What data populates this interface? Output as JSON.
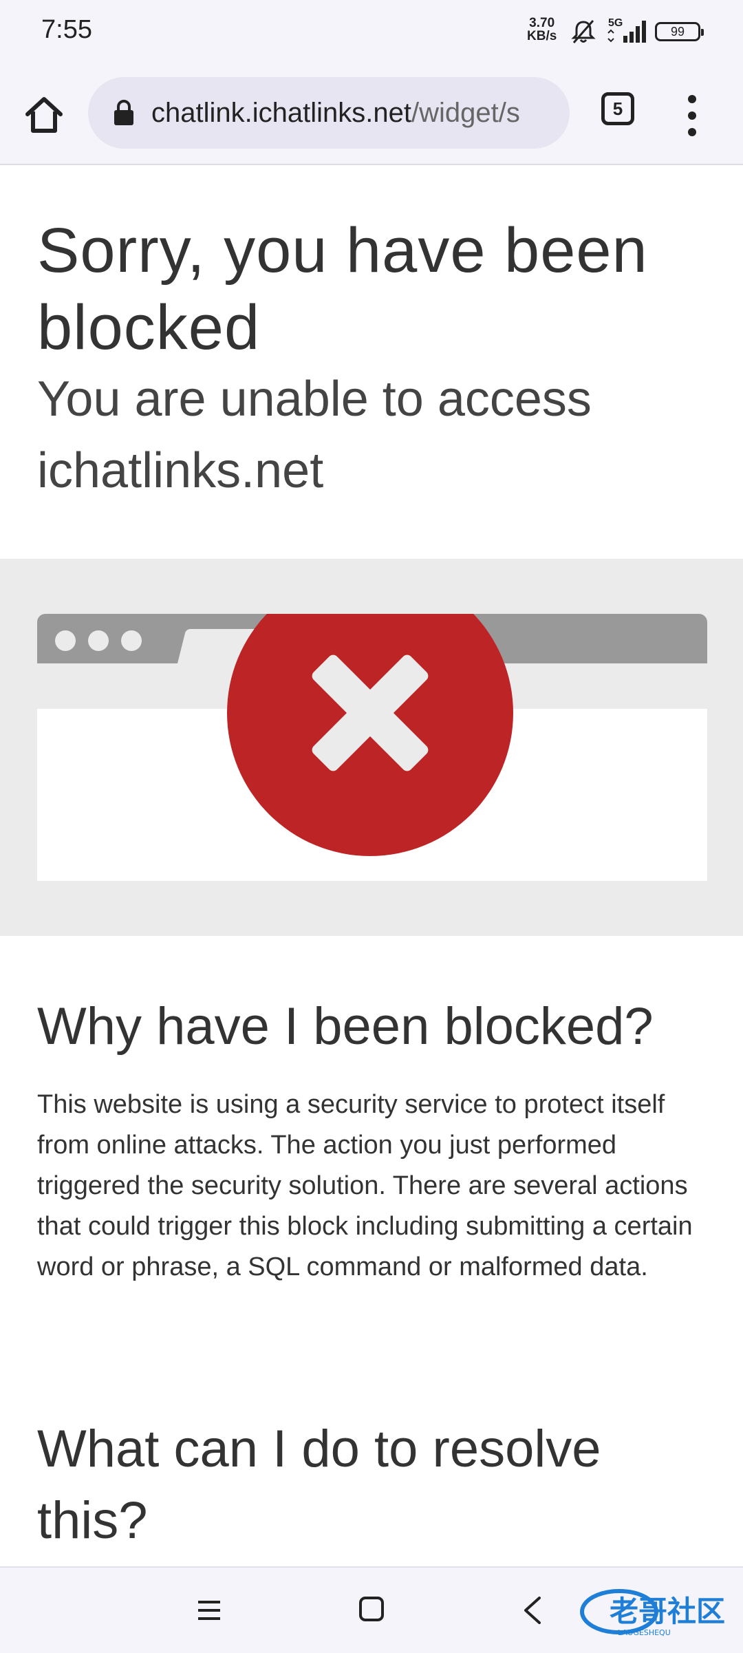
{
  "status_bar": {
    "time": "7:55",
    "speed_value": "3.70",
    "speed_unit": "KB/s",
    "network": "5G",
    "battery": "99"
  },
  "toolbar": {
    "url_host": "chatlink.ichatlinks.net",
    "url_path": "/widget/s",
    "tab_count": "5"
  },
  "page": {
    "title": "Sorry, you have been blocked",
    "subtitle": "You are unable to access ichatlinks.net",
    "why_heading": "Why have I been blocked?",
    "why_text": "This website is using a security service to protect itself from online attacks. The action you just performed triggered the security solution. There are several actions that could trigger this block including submitting a certain word or phrase, a SQL command or malformed data.",
    "resolve_heading": "What can I do to resolve this?"
  },
  "watermark": {
    "text": "老哥社区",
    "sub": "LAOGESHEQU"
  },
  "colors": {
    "error_red": "#bd2426",
    "chrome_bg": "#f6f4fb",
    "url_bar_bg": "#e8e5f2",
    "hero_bg": "#ebebeb",
    "browser_gray": "#999999"
  },
  "icons": [
    "home-icon",
    "lock-icon",
    "tab-switcher-icon",
    "more-vert-icon",
    "error-x-icon",
    "nav-menu-icon",
    "nav-home-icon",
    "nav-back-icon"
  ]
}
